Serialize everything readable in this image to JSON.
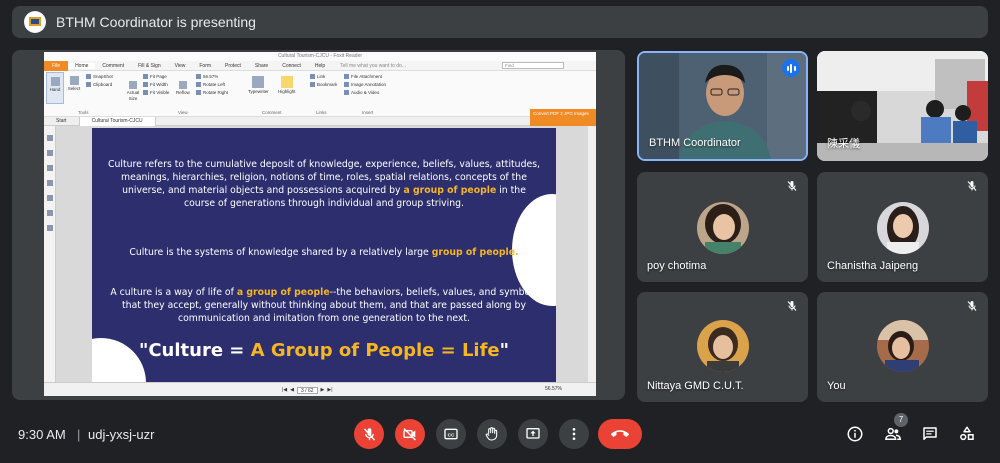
{
  "header": {
    "presenting_text": "BTHM Coordinator is presenting"
  },
  "reader": {
    "window_title": "Cultural Tourism-CJCU - Foxit Reader",
    "menu": [
      "File",
      "Home",
      "Comment",
      "Fill & Sign",
      "View",
      "Form",
      "Protect",
      "Share",
      "Connect",
      "Help"
    ],
    "tell_me": "Tell me what you want to do...",
    "find_placeholder": "Find",
    "ribbon": {
      "hand": "Hand",
      "select": "Select",
      "snapshot": "SnapShot",
      "clipboard": "Clipboard",
      "actual_size": "Actual Size",
      "fit_page": "Fit Page",
      "fit_width": "Fit Width",
      "fit_visible": "Fit Visible",
      "reflow": "Reflow",
      "zoom": "56.57%",
      "rotate_left": "Rotate Left",
      "rotate_right": "Rotate Right",
      "typewriter": "Typewriter",
      "highlight": "Highlight",
      "link": "Link",
      "bookmark": "Bookmark",
      "file_attachment": "File Attachment",
      "image_annotation": "Image Annotation",
      "audio_video": "Audio & Video",
      "group_tools": "Tools",
      "group_view": "View",
      "group_comment": "Comment",
      "group_links": "Links",
      "group_insert": "Insert"
    },
    "tabs": [
      "Start",
      "Cultural Tourism-CJCU"
    ],
    "convert_banner": "Convert PDF 2 JPG Images",
    "page_indicator": "3 / 62",
    "status_zoom": "56.57%"
  },
  "slide": {
    "para1_before": "Culture refers to the cumulative deposit of knowledge, experience, beliefs, values, attitudes, meanings, hierarchies, religion, notions of time, roles, spatial relations, concepts of the universe, and material objects and possessions acquired by ",
    "para1_hl": "a group of people",
    "para1_after": " in the course of generations through individual and group striving.",
    "para2_before": "Culture is the systems of knowledge shared by a relatively large ",
    "para2_hl": "group of people.",
    "para3_before": "A culture is a way of life of ",
    "para3_hl": "a group of people",
    "para3_after": "--the behaviors, beliefs, values, and symbols that they accept, generally without thinking about them, and that are passed along by communication and imitation from one generation to the next.",
    "big_open": "\"Culture = ",
    "big_hl": "A Group of People = Life",
    "big_close": "\""
  },
  "participants": [
    {
      "name": "BTHM Coordinator"
    },
    {
      "name": "陳采儀"
    },
    {
      "name": "poy chotima"
    },
    {
      "name": "Chanistha Jaipeng"
    },
    {
      "name": "Nittaya GMD C.U.T."
    },
    {
      "name": "You"
    }
  ],
  "meeting": {
    "time": "9:30 AM",
    "separator": "|",
    "code": "udj-yxsj-uzr",
    "participant_count": "7"
  },
  "colors": {
    "accent_red": "#ea4335",
    "speaking_blue": "#1a73e8",
    "slide_bg": "#2d2e6e",
    "slide_highlight": "#f5b622"
  }
}
